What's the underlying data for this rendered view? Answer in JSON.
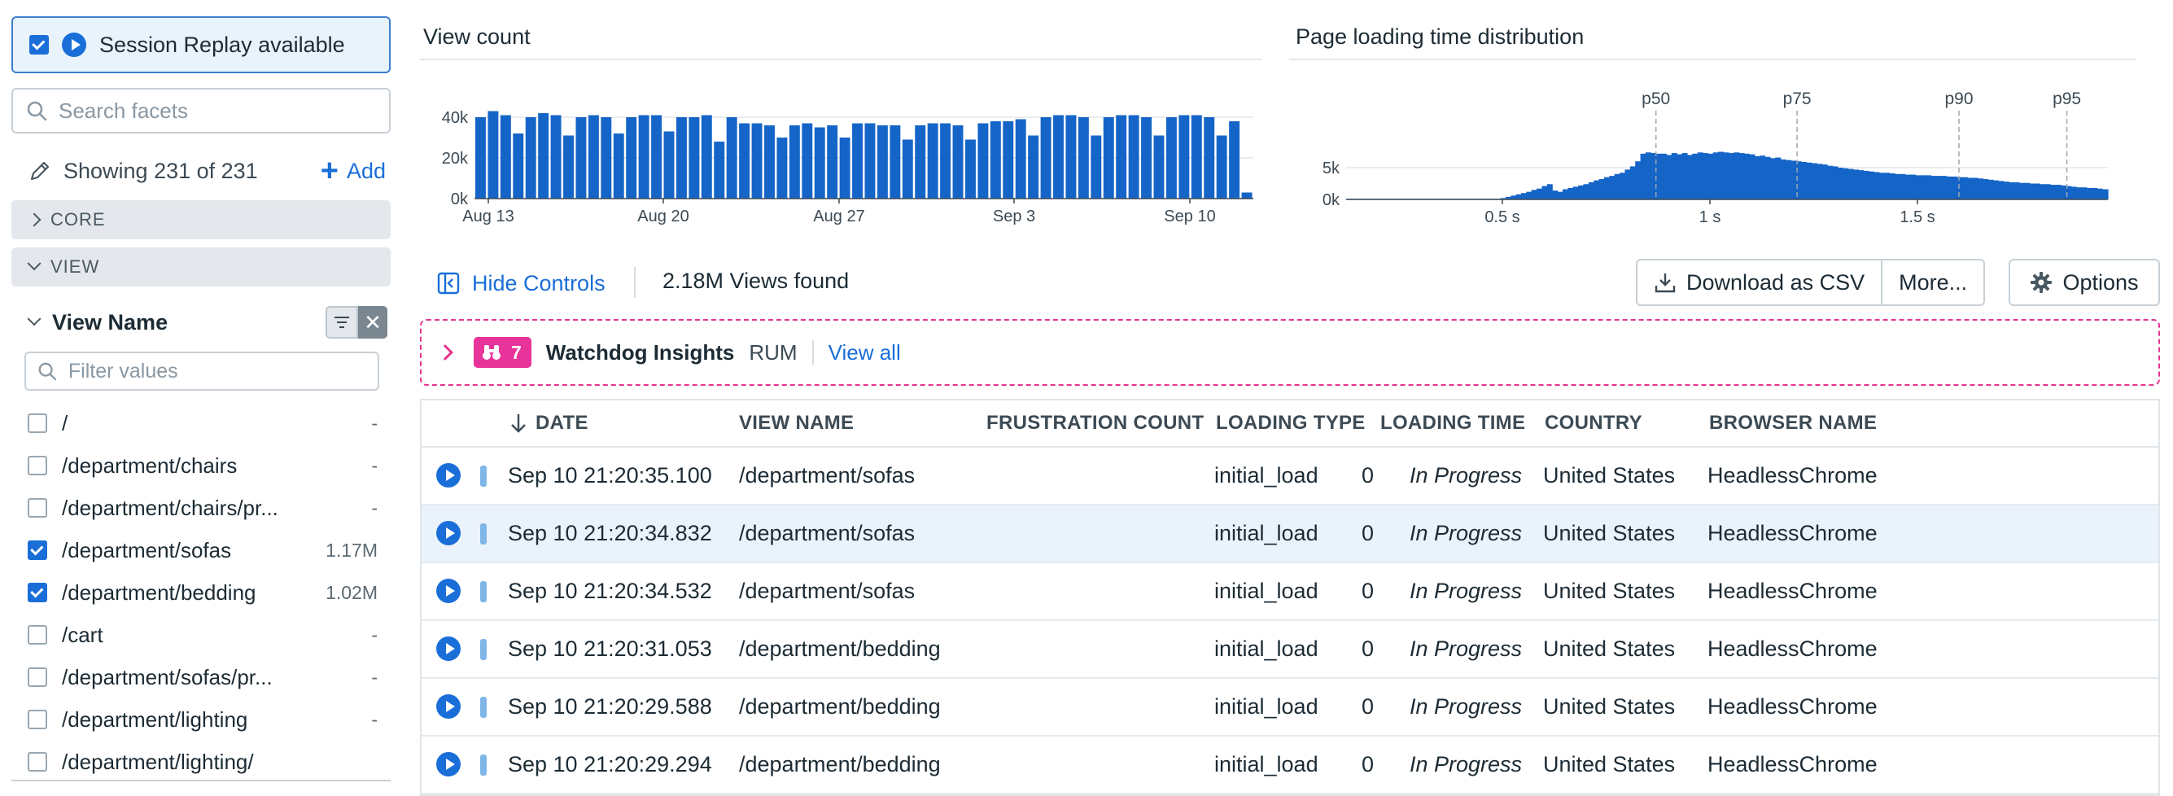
{
  "sidebar": {
    "session_replay_label": "Session Replay available",
    "session_replay_checked": true,
    "search_placeholder": "Search facets",
    "showing_text": "Showing 231 of 231",
    "add_label": "Add",
    "sections": [
      "CORE",
      "VIEW"
    ],
    "view_name": {
      "title": "View Name",
      "filter_placeholder": "Filter values",
      "items": [
        {
          "label": "/",
          "count": "-",
          "checked": false
        },
        {
          "label": "/department/chairs",
          "count": "-",
          "checked": false
        },
        {
          "label": "/department/chairs/pr...",
          "count": "-",
          "checked": false
        },
        {
          "label": "/department/sofas",
          "count": "1.17M",
          "checked": true
        },
        {
          "label": "/department/bedding",
          "count": "1.02M",
          "checked": true
        },
        {
          "label": "/cart",
          "count": "-",
          "checked": false
        },
        {
          "label": "/department/sofas/pr...",
          "count": "-",
          "checked": false
        },
        {
          "label": "/department/lighting",
          "count": "-",
          "checked": false
        },
        {
          "label": "/department/lighting/",
          "count": "",
          "checked": false
        }
      ]
    }
  },
  "charts": {
    "view_count_title": "View count",
    "page_loading_title": "Page loading time distribution"
  },
  "chart_data": [
    {
      "type": "bar",
      "title": "View count",
      "x_tick_labels": [
        "Aug 13",
        "Aug 20",
        "Aug 27",
        "Sep 3",
        "Sep 10"
      ],
      "y_tick_labels": [
        "0k",
        "20k",
        "40k"
      ],
      "ylim": [
        0,
        50000
      ],
      "values": [
        40000,
        43000,
        41000,
        32000,
        40000,
        42000,
        41000,
        31000,
        40000,
        41000,
        40000,
        32000,
        40000,
        41000,
        41000,
        33000,
        40000,
        40000,
        41000,
        28000,
        40000,
        37000,
        37000,
        36000,
        30000,
        36000,
        37000,
        35000,
        36000,
        30000,
        37000,
        37000,
        36000,
        36000,
        29000,
        36000,
        37000,
        37000,
        36000,
        29000,
        37000,
        38000,
        38000,
        39000,
        31000,
        40000,
        41000,
        41000,
        40000,
        31000,
        40000,
        41000,
        41000,
        40000,
        31000,
        40000,
        41000,
        41000,
        40000,
        31000,
        38000,
        3000
      ]
    },
    {
      "type": "bar",
      "title": "Page loading time distribution",
      "x_tick_labels": [
        "0.5 s",
        "1 s",
        "1.5 s"
      ],
      "y_tick_labels": [
        "0k",
        "5k"
      ],
      "ylim": [
        0,
        6500
      ],
      "percentiles": [
        {
          "name": "p50",
          "x": 0.87
        },
        {
          "name": "p75",
          "x": 1.21
        },
        {
          "name": "p90",
          "x": 1.6
        },
        {
          "name": "p95",
          "x": 1.86
        }
      ],
      "bins": {
        "start": 0.12,
        "width": 0.0125
      },
      "values": [
        100,
        100,
        100,
        100,
        100,
        100,
        100,
        100,
        100,
        100,
        100,
        100,
        100,
        100,
        100,
        100,
        100,
        100,
        100,
        100,
        100,
        100,
        100,
        100,
        100,
        100,
        100,
        100,
        100,
        100,
        200,
        400,
        600,
        800,
        1000,
        1200,
        1500,
        1700,
        2100,
        2400,
        1400,
        1200,
        1600,
        1800,
        2000,
        2200,
        2400,
        2700,
        3000,
        3200,
        3500,
        3700,
        4000,
        4200,
        4700,
        5200,
        6000,
        7200,
        7400,
        7300,
        7200,
        7200,
        7000,
        7300,
        7100,
        7300,
        7000,
        7200,
        7400,
        7300,
        7200,
        7400,
        7500,
        7400,
        7300,
        7400,
        7300,
        7200,
        7100,
        6800,
        6900,
        6700,
        6500,
        6600,
        6300,
        6200,
        6100,
        6000,
        5900,
        5800,
        5700,
        5600,
        5500,
        5300,
        5200,
        5000,
        4900,
        4800,
        4700,
        4600,
        4500,
        4400,
        4300,
        4200,
        4200,
        4100,
        4000,
        4000,
        3900,
        3900,
        3800,
        3800,
        3800,
        3700,
        3700,
        3700,
        3600,
        3600,
        3500,
        3500,
        3400,
        3400,
        3300,
        3200,
        3100,
        3000,
        2900,
        2800,
        2700,
        2700,
        2600,
        2600,
        2500,
        2500,
        2400,
        2400,
        2300,
        2300,
        2200,
        2100,
        2000,
        1900,
        1900,
        1800,
        1800,
        1700,
        1600,
        1600,
        1500,
        1500,
        1400,
        1400,
        1300,
        1200,
        1200,
        1100,
        1100,
        1000,
        900,
        800,
        700,
        600,
        500,
        400
      ]
    }
  ],
  "toolbar": {
    "hide_controls_label": "Hide Controls",
    "views_found": "2.18M Views found",
    "download_label": "Download as CSV",
    "more_label": "More...",
    "options_label": "Options"
  },
  "watchdog": {
    "count": "7",
    "title": "Watchdog Insights",
    "tag": "RUM",
    "view_all_label": "View all"
  },
  "table": {
    "columns": [
      "DATE",
      "VIEW NAME",
      "FRUSTRATION COUNT",
      "LOADING TYPE",
      "LOADING TIME",
      "COUNTRY",
      "BROWSER NAME"
    ],
    "sort_column": "DATE",
    "rows": [
      {
        "date": "Sep 10 21:20:35.100",
        "view_name": "/department/sofas",
        "frustration": "0",
        "loading_type": "initial_load",
        "loading_time": "In Progress",
        "country": "United States",
        "browser": "HeadlessChrome"
      },
      {
        "date": "Sep 10 21:20:34.832",
        "view_name": "/department/sofas",
        "frustration": "0",
        "loading_type": "initial_load",
        "loading_time": "In Progress",
        "country": "United States",
        "browser": "HeadlessChrome"
      },
      {
        "date": "Sep 10 21:20:34.532",
        "view_name": "/department/sofas",
        "frustration": "0",
        "loading_type": "initial_load",
        "loading_time": "In Progress",
        "country": "United States",
        "browser": "HeadlessChrome"
      },
      {
        "date": "Sep 10 21:20:31.053",
        "view_name": "/department/bedding",
        "frustration": "0",
        "loading_type": "initial_load",
        "loading_time": "In Progress",
        "country": "United States",
        "browser": "HeadlessChrome"
      },
      {
        "date": "Sep 10 21:20:29.588",
        "view_name": "/department/bedding",
        "frustration": "0",
        "loading_type": "initial_load",
        "loading_time": "In Progress",
        "country": "United States",
        "browser": "HeadlessChrome"
      },
      {
        "date": "Sep 10 21:20:29.294",
        "view_name": "/department/bedding",
        "frustration": "0",
        "loading_type": "initial_load",
        "loading_time": "In Progress",
        "country": "United States",
        "browser": "HeadlessChrome"
      }
    ],
    "highlighted_row_index": 1
  },
  "colors": {
    "accent": "#1a6ed8",
    "bar": "#1565c8",
    "watchdog": "#e3358f",
    "row_highlight": "#eaf3fb"
  },
  "icons": [
    "checkbox-checked-icon",
    "play-icon",
    "search-icon",
    "pencil-icon",
    "plus-icon",
    "chevron-right-icon",
    "chevron-down-icon",
    "filter-icon",
    "close-icon",
    "hide-controls-icon",
    "download-icon",
    "gear-icon",
    "binoculars-icon",
    "sort-down-arrow-icon"
  ]
}
